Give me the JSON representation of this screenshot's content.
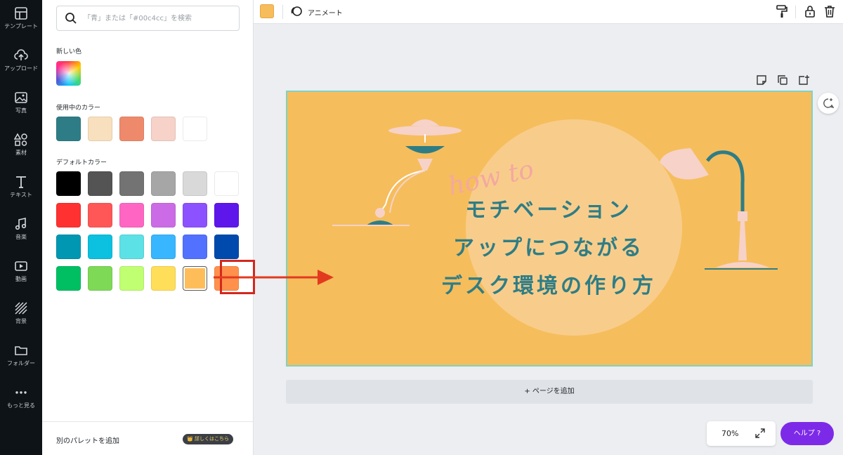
{
  "sidebar": {
    "items": [
      {
        "label": "テンプレート",
        "icon": "template-icon"
      },
      {
        "label": "アップロード",
        "icon": "upload-icon"
      },
      {
        "label": "写真",
        "icon": "photo-icon"
      },
      {
        "label": "素材",
        "icon": "elements-icon"
      },
      {
        "label": "テキスト",
        "icon": "text-icon"
      },
      {
        "label": "音楽",
        "icon": "music-icon"
      },
      {
        "label": "動画",
        "icon": "video-icon"
      },
      {
        "label": "背景",
        "icon": "background-icon"
      },
      {
        "label": "フォルダー",
        "icon": "folder-icon"
      },
      {
        "label": "もっと見る",
        "icon": "more-icon"
      }
    ]
  },
  "panel": {
    "search_placeholder": "「青」または「#00c4cc」を検索",
    "new_color_label": "新しい色",
    "used_colors_label": "使用中のカラー",
    "used_colors": [
      "#2e7d86",
      "#f8dfbd",
      "#ee8a6b",
      "#f6d2c8",
      "#ffffff"
    ],
    "default_colors_label": "デフォルトカラー",
    "default_colors": [
      [
        "#000000",
        "#545454",
        "#737373",
        "#a6a6a6",
        "#d9d9d9",
        "#ffffff"
      ],
      [
        "#ff3131",
        "#ff5757",
        "#ff66c4",
        "#cb6ce6",
        "#8c52ff",
        "#5e17eb"
      ],
      [
        "#0097b2",
        "#0cc0df",
        "#5ce1e6",
        "#38b6ff",
        "#5271ff",
        "#004aad"
      ],
      [
        "#00bf63",
        "#7ed957",
        "#c1ff72",
        "#ffde59",
        "#ffbd59",
        "#ff914d"
      ]
    ],
    "selected_color": "#ffbd59",
    "add_palette_label": "別のパレットを追加",
    "more_badge": "👑 詳しくはこちら"
  },
  "toolbar": {
    "current_color": "#f7bc5b",
    "animate_label": "アニメート"
  },
  "canvas": {
    "background_color": "#f6bd5c",
    "script_text": "how to",
    "title_lines": [
      "モチベーション",
      "アップにつながる",
      "デスク環境の作り方"
    ],
    "add_page_label": "+ ページを追加"
  },
  "footer": {
    "zoom": "70%",
    "help_label": "ヘルプ ?"
  },
  "colors": {
    "accent": "#7d2ae8",
    "highlight": "#d3271d",
    "teal": "#2e7d86"
  }
}
